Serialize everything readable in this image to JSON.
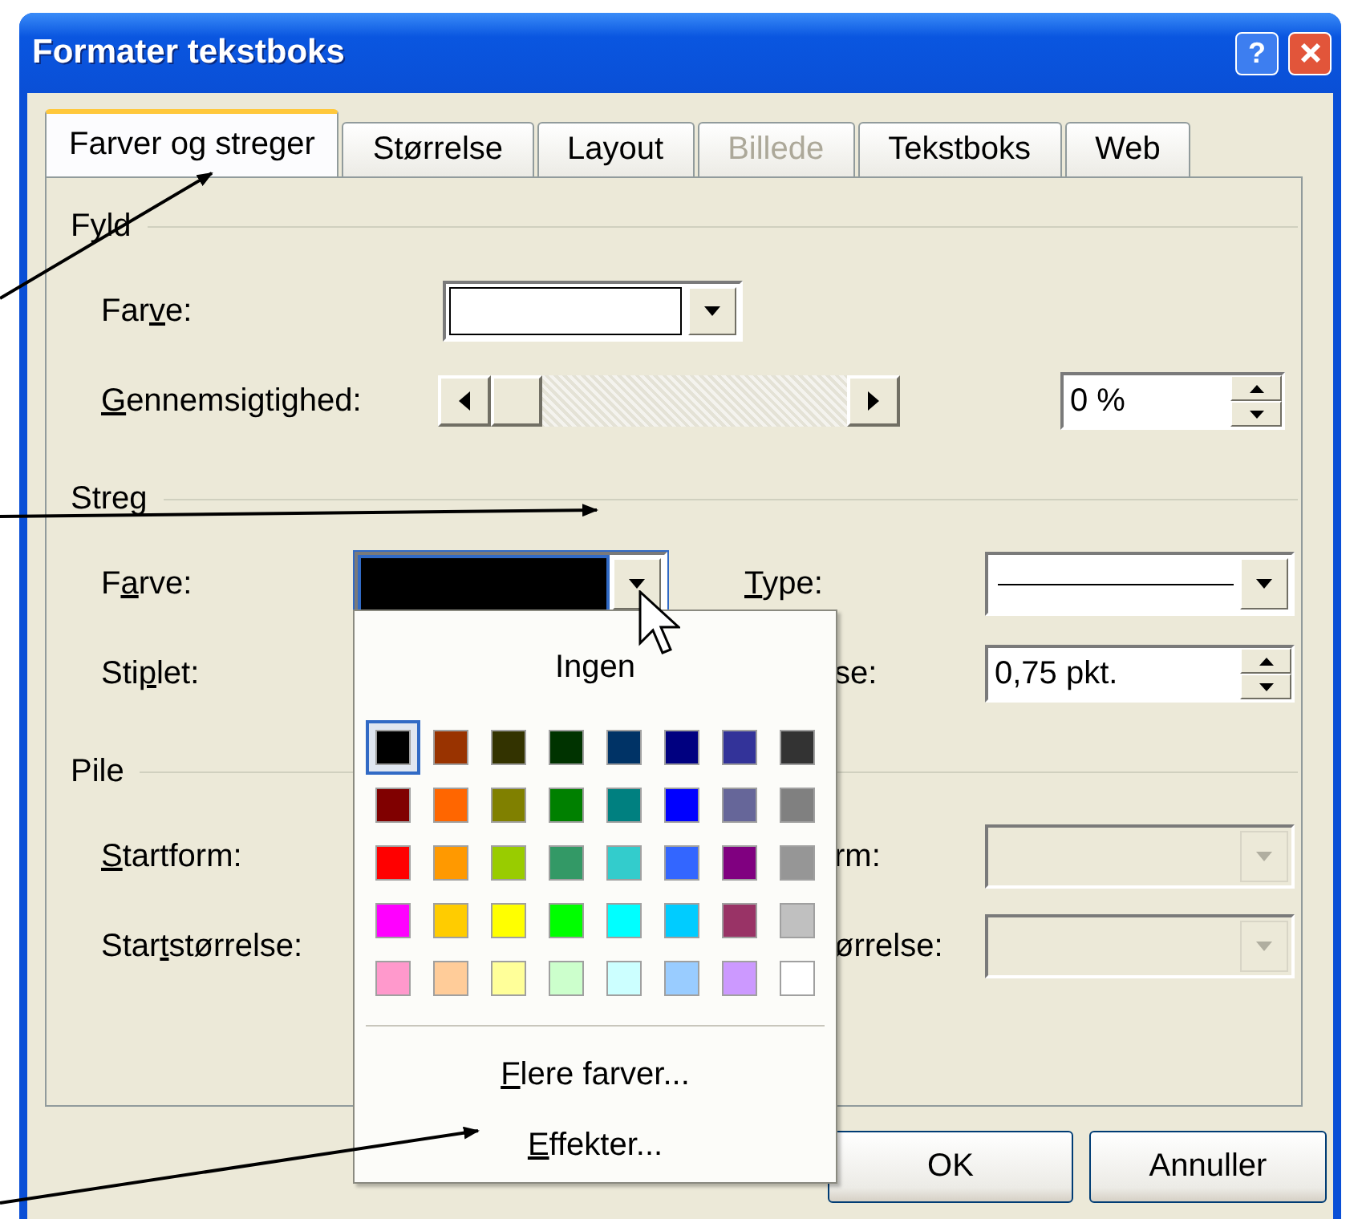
{
  "window": {
    "title": "Formater tekstboks",
    "help_label": "?"
  },
  "tabs": [
    {
      "label": "Farver og streger",
      "selected": true,
      "disabled": false
    },
    {
      "label": "Størrelse",
      "selected": false,
      "disabled": false
    },
    {
      "label": "Layout",
      "selected": false,
      "disabled": false
    },
    {
      "label": "Billede",
      "selected": false,
      "disabled": true
    },
    {
      "label": "Tekstboks",
      "selected": false,
      "disabled": false
    },
    {
      "label": "Web",
      "selected": false,
      "disabled": false
    }
  ],
  "groups": [
    {
      "title": "Fyld",
      "rows": [
        [
          {
            "label": {
              "before": "Far",
              "key": "v",
              "after": "e:"
            },
            "kind": "color_combo",
            "color": "#ffffff",
            "focused": false
          }
        ],
        [
          {
            "label": {
              "key": "G",
              "after": "ennemsigtighed:"
            },
            "kind": "slider",
            "level": 0
          },
          {
            "kind": "spin",
            "value": "0 %"
          }
        ]
      ]
    },
    {
      "title": "Streg",
      "rows": [
        [
          {
            "label": {
              "before": "F",
              "key": "a",
              "after": "rve:"
            },
            "kind": "color_combo",
            "color": "#000000",
            "focused": true
          },
          {
            "label": {
              "key": "T",
              "after": "ype:"
            },
            "kind": "line_combo"
          }
        ],
        [
          {
            "label": {
              "before": "Sti",
              "key": "p",
              "after": "let:"
            },
            "kind": "covered"
          },
          {
            "label": {
              "after": "se:"
            },
            "kind": "spin",
            "value": "0,75 pkt."
          }
        ]
      ]
    },
    {
      "title": "Pile",
      "rows": [
        [
          {
            "label": {
              "key": "S",
              "after": "tartform:"
            },
            "kind": "covered"
          },
          {
            "label": {
              "after": "rm:"
            },
            "kind": "combo",
            "disabled": true
          }
        ],
        [
          {
            "label": {
              "before": "Star",
              "key": "t",
              "after": "størrelse:"
            },
            "kind": "covered"
          },
          {
            "label": {
              "after": "ørrelse:"
            },
            "kind": "combo",
            "disabled": true
          }
        ]
      ]
    }
  ],
  "popup": {
    "none_label": "Ingen",
    "swatches": [
      {
        "color": "#000000",
        "selected": true
      },
      {
        "color": "#993300",
        "selected": false
      },
      {
        "color": "#333300",
        "selected": false
      },
      {
        "color": "#003300",
        "selected": false
      },
      {
        "color": "#003366",
        "selected": false
      },
      {
        "color": "#000080",
        "selected": false
      },
      {
        "color": "#333399",
        "selected": false
      },
      {
        "color": "#333333",
        "selected": false
      },
      {
        "color": "#800000",
        "selected": false
      },
      {
        "color": "#ff6600",
        "selected": false
      },
      {
        "color": "#808000",
        "selected": false
      },
      {
        "color": "#008000",
        "selected": false
      },
      {
        "color": "#008080",
        "selected": false
      },
      {
        "color": "#0000ff",
        "selected": false
      },
      {
        "color": "#666699",
        "selected": false
      },
      {
        "color": "#808080",
        "selected": false
      },
      {
        "color": "#ff0000",
        "selected": false
      },
      {
        "color": "#ff9900",
        "selected": false
      },
      {
        "color": "#99cc00",
        "selected": false
      },
      {
        "color": "#339966",
        "selected": false
      },
      {
        "color": "#33cccc",
        "selected": false
      },
      {
        "color": "#3366ff",
        "selected": false
      },
      {
        "color": "#800080",
        "selected": false
      },
      {
        "color": "#969696",
        "selected": false
      },
      {
        "color": "#ff00ff",
        "selected": false
      },
      {
        "color": "#ffcc00",
        "selected": false
      },
      {
        "color": "#ffff00",
        "selected": false
      },
      {
        "color": "#00ff00",
        "selected": false
      },
      {
        "color": "#00ffff",
        "selected": false
      },
      {
        "color": "#00ccff",
        "selected": false
      },
      {
        "color": "#993366",
        "selected": false
      },
      {
        "color": "#c0c0c0",
        "selected": false
      },
      {
        "color": "#ff99cc",
        "selected": false
      },
      {
        "color": "#ffcc99",
        "selected": false
      },
      {
        "color": "#ffff99",
        "selected": false
      },
      {
        "color": "#ccffcc",
        "selected": false
      },
      {
        "color": "#ccffff",
        "selected": false
      },
      {
        "color": "#99ccff",
        "selected": false
      },
      {
        "color": "#cc99ff",
        "selected": false
      },
      {
        "color": "#ffffff",
        "selected": false
      }
    ],
    "items": [
      {
        "label": {
          "key": "F",
          "after": "lere farver..."
        }
      },
      {
        "label": {
          "key": "E",
          "after": "ffekter..."
        }
      }
    ]
  },
  "buttons": [
    {
      "label": "OK"
    },
    {
      "label": "Annuller"
    }
  ]
}
